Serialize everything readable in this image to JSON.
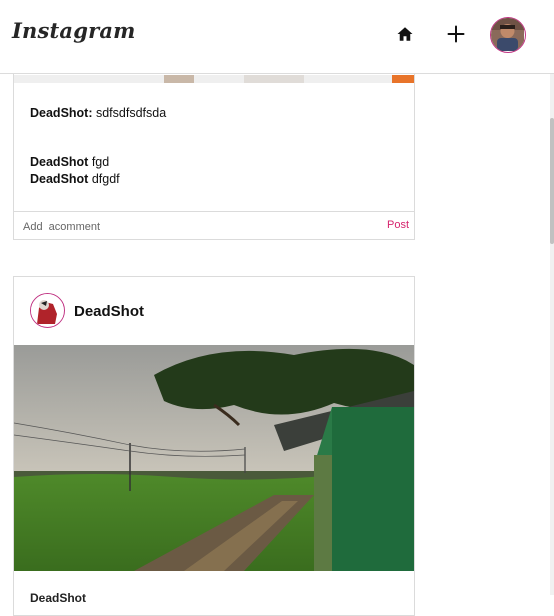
{
  "header": {
    "brand": "Instagram",
    "icons": [
      "home-icon",
      "add-icon",
      "profile-avatar"
    ]
  },
  "post1": {
    "comments": [
      {
        "user": "DeadShot:",
        "text": " sdfsdfsdfsda"
      },
      {
        "user": "DeadShot",
        "text": " fgd"
      },
      {
        "user": "DeadShot",
        "text": " dfgdf"
      }
    ],
    "add_comment_placeholder": "Add  acomment",
    "post_label": "Post"
  },
  "post2": {
    "username": "DeadShot",
    "caption_partial": "DeadShot"
  },
  "colors": {
    "accent": "#d6246e",
    "avatar_ring": "#c13584",
    "border": "#dbdbdb"
  }
}
